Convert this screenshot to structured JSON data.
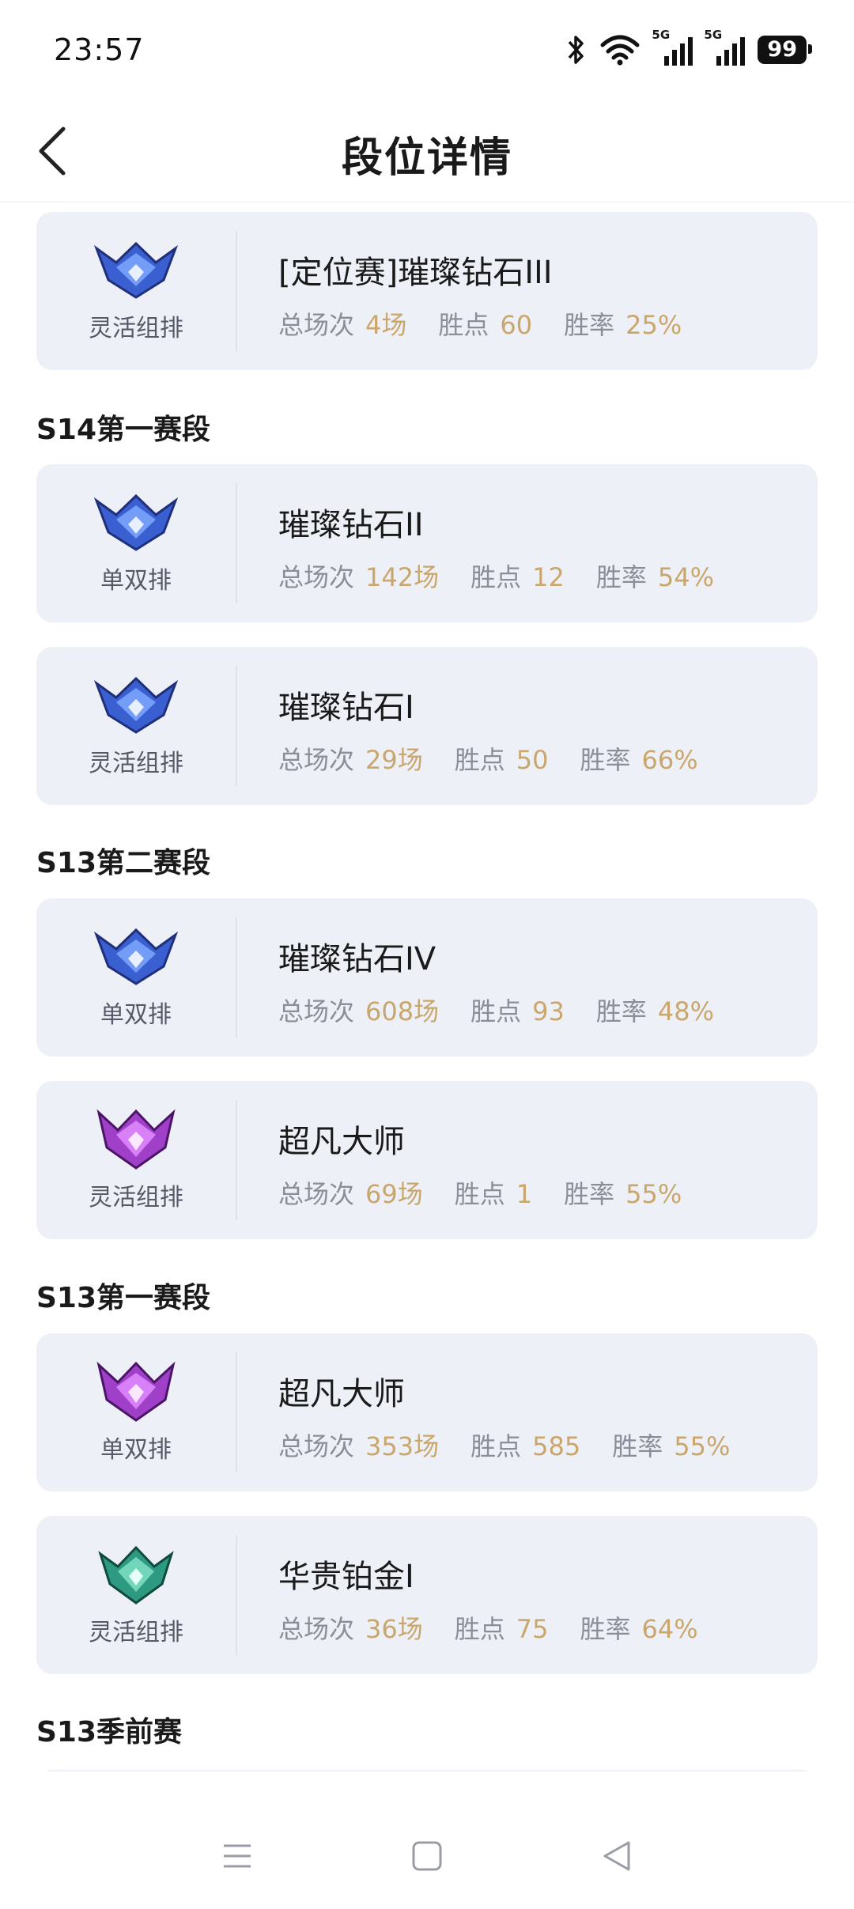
{
  "status": {
    "time": "23:57",
    "battery": "99",
    "net1": "5G",
    "net2": "5G"
  },
  "header": {
    "title": "段位详情"
  },
  "stat_labels": {
    "games": "总场次",
    "points": "胜点",
    "winrate": "胜率"
  },
  "sections": [
    {
      "title": "S14第一赛段"
    },
    {
      "title": "S13第二赛段"
    },
    {
      "title": "S13第一赛段"
    },
    {
      "title": "S13季前赛"
    }
  ],
  "cards": [
    {
      "queue": "灵活组排",
      "rank": "[定位赛]璀璨钻石III",
      "games": "4场",
      "points": "60",
      "winrate": "25%",
      "emblem": "diamond-emblem-icon",
      "color": "#3a5fd0"
    },
    {
      "queue": "单双排",
      "rank": "璀璨钻石II",
      "games": "142场",
      "points": "12",
      "winrate": "54%",
      "emblem": "diamond-emblem-icon",
      "color": "#3a5fd0"
    },
    {
      "queue": "灵活组排",
      "rank": "璀璨钻石I",
      "games": "29场",
      "points": "50",
      "winrate": "66%",
      "emblem": "diamond-emblem-icon",
      "color": "#3a5fd0"
    },
    {
      "queue": "单双排",
      "rank": "璀璨钻石IV",
      "games": "608场",
      "points": "93",
      "winrate": "48%",
      "emblem": "diamond-emblem-icon",
      "color": "#3a5fd0"
    },
    {
      "queue": "灵活组排",
      "rank": "超凡大师",
      "games": "69场",
      "points": "1",
      "winrate": "55%",
      "emblem": "master-emblem-icon",
      "color": "#a040c8"
    },
    {
      "queue": "单双排",
      "rank": "超凡大师",
      "games": "353场",
      "points": "585",
      "winrate": "55%",
      "emblem": "master-emblem-icon",
      "color": "#a040c8"
    },
    {
      "queue": "灵活组排",
      "rank": "华贵铂金I",
      "games": "36场",
      "points": "75",
      "winrate": "64%",
      "emblem": "platinum-emblem-icon",
      "color": "#2e9a82"
    }
  ]
}
